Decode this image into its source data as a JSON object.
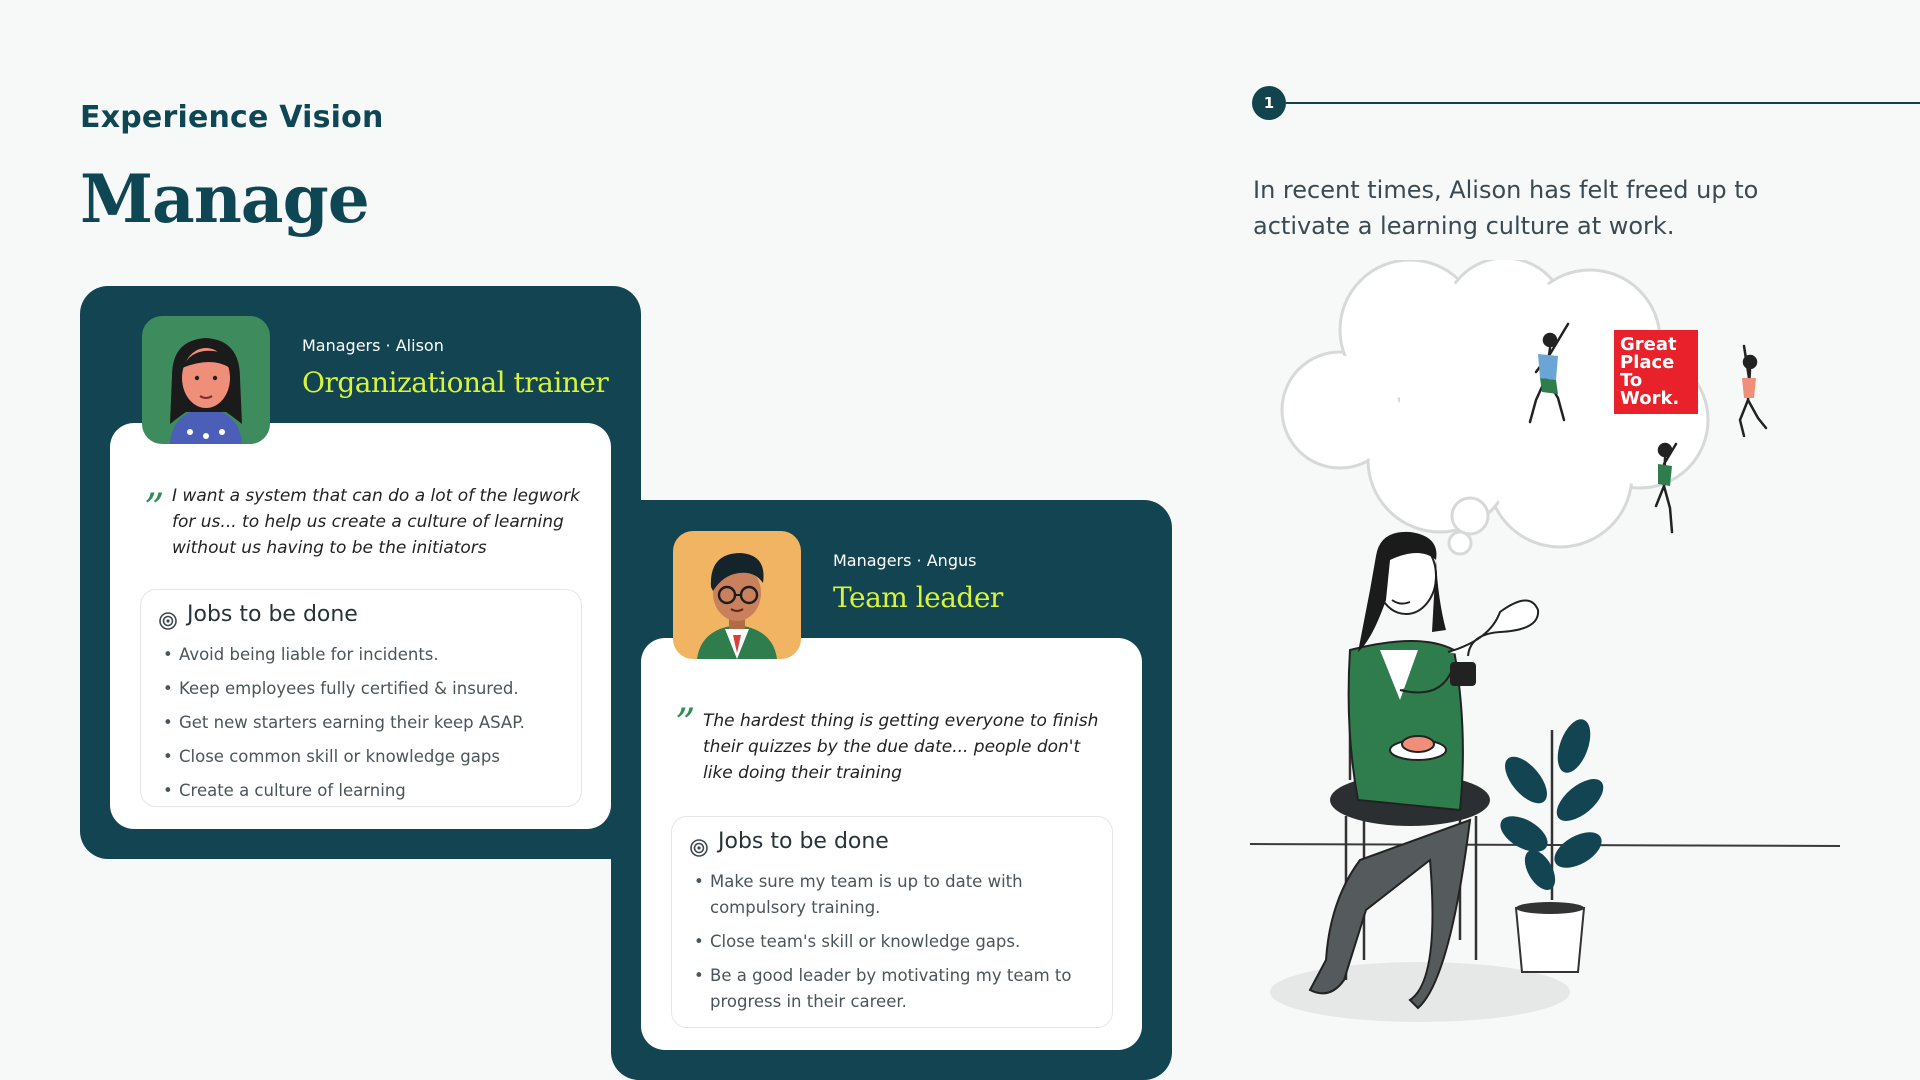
{
  "header": {
    "eyebrow": "Experience Vision",
    "title": "Manage"
  },
  "stepper": {
    "step_number": "1",
    "intro_text": "In recent times, Alison has felt freed up to activate a learning culture at work."
  },
  "personas": [
    {
      "role": "Managers · Alison",
      "name": "Organizational trainer",
      "quote_mark": "”",
      "quote": "I want a system that can do a lot of the legwork for us... to help us create a culture of learning without us having to be the initiators",
      "jobs_title": "Jobs to be done",
      "jobs": [
        "Avoid being liable for incidents.",
        "Keep employees fully certified & insured.",
        "Get new starters earning their keep ASAP.",
        "Close common skill or knowledge gaps",
        "Create a culture of learning"
      ]
    },
    {
      "role": "Managers · Angus",
      "name": "Team leader",
      "quote_mark": "”",
      "quote": "The hardest thing is getting everyone to finish their quizzes by the due date... people don't like doing their training",
      "jobs_title": "Jobs to be done",
      "jobs": [
        "Make sure my team is up to date with compulsory training.",
        "Close team's skill or knowledge gaps.",
        "Be a good leader by motivating my team to progress in their career."
      ]
    }
  ],
  "illustration": {
    "logo_text": "Great Place To Work."
  },
  "colors": {
    "brand_dark": "#124451",
    "accent_lime": "#d7f43b",
    "quote_green": "#2f8e57",
    "logo_red": "#e8212b"
  }
}
